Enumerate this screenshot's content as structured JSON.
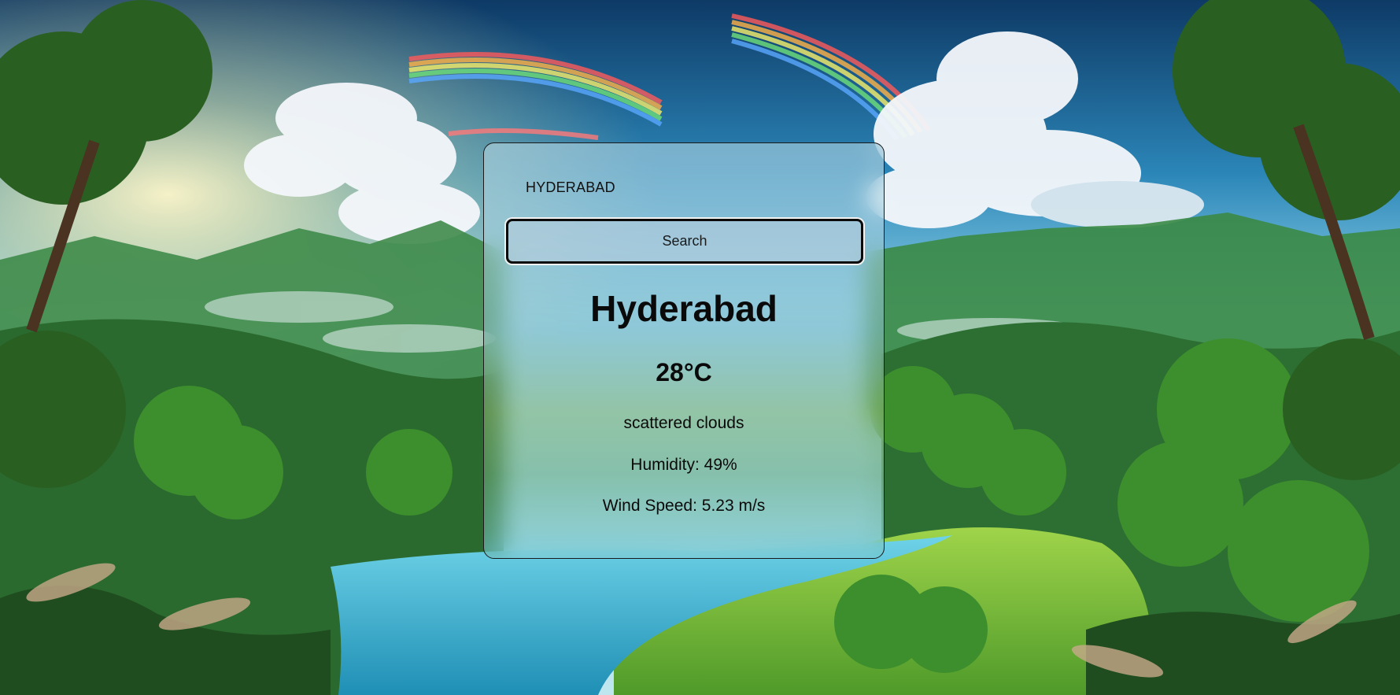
{
  "background": {
    "description_icon": "landscape-illustration",
    "sky_color": "#2a7fb0",
    "foliage_color": "#2f6f3a",
    "river_color": "#3fb4d4"
  },
  "weather_card": {
    "city_input_value": "HYDERABAD",
    "search_label": "Search",
    "city_name": "Hyderabad",
    "temperature": "28°C",
    "description": "scattered clouds",
    "humidity": "Humidity: 49%",
    "wind_speed": "Wind Speed: 5.23 m/s"
  }
}
